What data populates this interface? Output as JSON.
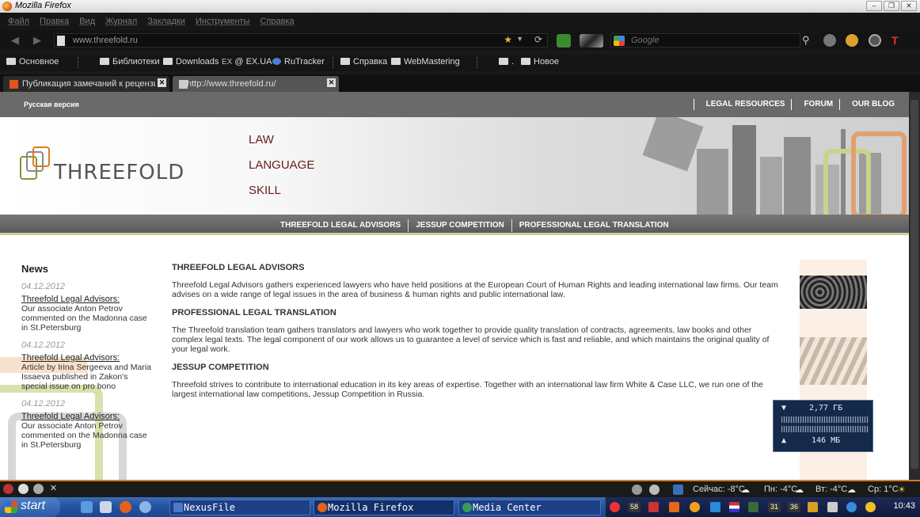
{
  "window": {
    "title": "Mozilla Firefox"
  },
  "menu": [
    "Файл",
    "Правка",
    "Вид",
    "Журнал",
    "Закладки",
    "Инструменты",
    "Справка"
  ],
  "nav": {
    "url": "www.threefold.ru",
    "search_placeholder": "Google"
  },
  "bookmarks": {
    "basic": "Основное",
    "libs": "Библиотеки",
    "downloads": "Downloads",
    "ex_prefix": "EX",
    "ex": "@ EX.UA",
    "rutracker": "RuTracker",
    "help": "Справка",
    "webmastering": "WebMastering",
    "dot": ".",
    "new": "Новое"
  },
  "tabs": [
    {
      "label": "Публикация замечаний к рецензи..."
    },
    {
      "label": "http://www.threefold.ru/"
    }
  ],
  "site": {
    "russian_version": "Русская версия",
    "top_links": [
      "LEGAL RESOURCES",
      "FORUM",
      "OUR BLOG"
    ],
    "logo": "THREEFOLD",
    "taglines": [
      "LAW",
      "LANGUAGE",
      "SKILL"
    ],
    "nav_links": [
      "THREEFOLD LEGAL ADVISORS",
      "JESSUP COMPETITION",
      "PROFESSIONAL LEGAL TRANSLATION"
    ],
    "news_title": "News",
    "news": [
      {
        "date": "04.12.2012",
        "head": "Threefold Legal Advisors:",
        "body": "Our associate Anton Petrov commented on the Madonna case in St.Petersburg"
      },
      {
        "date": "04.12.2012",
        "head": "Threefold Legal Advisors:",
        "body": "Article by Irina Sergeeva and Maria Issaeva published in Zakon's special issue on pro bono"
      },
      {
        "date": "04.12.2012",
        "head": "Threefold Legal Advisors:",
        "body": "Our associate Anton Petrov commented on the Madonna case in St.Petersburg"
      }
    ],
    "sections": [
      {
        "title": "THREEFOLD LEGAL ADVISORS",
        "text": "Threefold Legal Advisors gathers experienced lawyers who have held positions at the European Court of Human Rights and leading international law firms. Our team advises on a wide range of legal issues in the area of business & human rights and public international law."
      },
      {
        "title": "PROFESSIONAL LEGAL TRANSLATION",
        "text": "The Threefold translation team gathers translators and lawyers who work together to provide quality translation of contracts, agreements, law books and other complex legal texts. The legal component of our work allows us to guarantee a level of service which is fast and reliable, and which maintains the original quality of your legal work."
      },
      {
        "title": "JESSUP COMPETITION",
        "text": "Threefold strives to contribute to international education in its key areas of expertise. Together with an international law firm White & Case LLC, we run one of the largest international law competitions, Jessup Competition in Russia."
      }
    ]
  },
  "widget": {
    "down": "2,77 ГБ",
    "up": "146 МБ"
  },
  "weather": {
    "now": "Сейчас: -8°C",
    "mon": "Пн: -4°C",
    "tue": "Вт: -4°C",
    "wed": "Ср: 1°C"
  },
  "taskbar": {
    "start": "start",
    "tasks": [
      "NexusFile",
      "Mozilla Firefox",
      "Media Center"
    ],
    "tray_nums": [
      "58",
      "31",
      "36"
    ],
    "clock": "10:43"
  },
  "colors": {
    "accent_orange": "#d97a20",
    "tagline": "#6a1a1a",
    "xp_blue": "#2252a0"
  }
}
